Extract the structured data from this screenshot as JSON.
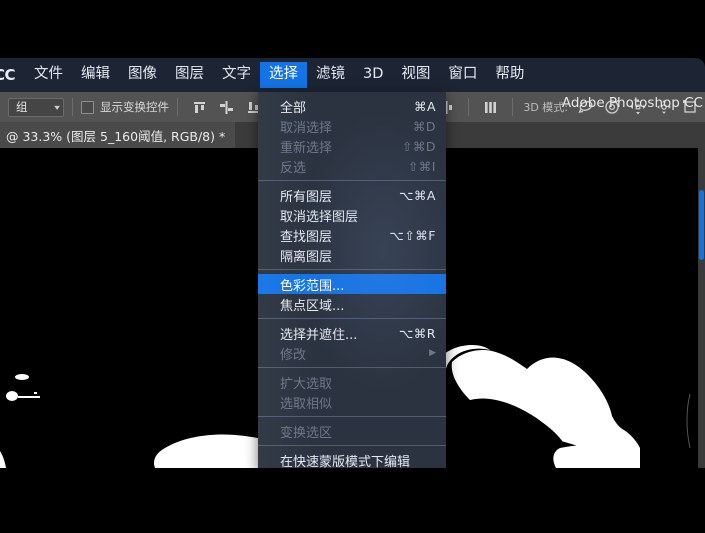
{
  "app": {
    "logo": "CC",
    "title": "Adobe Photoshop CC"
  },
  "menubar": {
    "items": [
      {
        "label": "文件",
        "active": false
      },
      {
        "label": "编辑",
        "active": false
      },
      {
        "label": "图像",
        "active": false
      },
      {
        "label": "图层",
        "active": false
      },
      {
        "label": "文字",
        "active": false
      },
      {
        "label": "选择",
        "active": true
      },
      {
        "label": "滤镜",
        "active": false
      },
      {
        "label": "3D",
        "active": false
      },
      {
        "label": "视图",
        "active": false
      },
      {
        "label": "窗口",
        "active": false
      },
      {
        "label": "帮助",
        "active": false
      }
    ]
  },
  "options_bar": {
    "group_select_value": "组",
    "show_transform_controls_label": "显示变换控件",
    "show_transform_controls_checked": false,
    "align_icons": [
      "align-top-edges-icon",
      "align-vertical-centers-icon",
      "align-bottom-edges-icon",
      "align-left-edges-icon",
      "align-horizontal-centers-icon",
      "align-right-edges-icon",
      "distribute-icon"
    ],
    "mode_3d_label": "3D 模式:",
    "mode_3d_icons": [
      "orbit-3d-icon",
      "roll-3d-icon",
      "pan-3d-icon",
      "slide-3d-icon",
      "scale-3d-icon"
    ]
  },
  "document": {
    "tab_label": "@ 33.3% (图层 5_160阈值, RGB/8) *",
    "zoom": "33.3%",
    "layer_name": "图层 5_160阈值",
    "color_mode": "RGB/8",
    "modified": true
  },
  "select_menu": {
    "title": "选择",
    "items": [
      {
        "label": "全部",
        "shortcut": "⌘A",
        "state": "enabled"
      },
      {
        "label": "取消选择",
        "shortcut": "⌘D",
        "state": "disabled"
      },
      {
        "label": "重新选择",
        "shortcut": "⇧⌘D",
        "state": "disabled"
      },
      {
        "label": "反选",
        "shortcut": "⇧⌘I",
        "state": "disabled"
      },
      {
        "type": "separator"
      },
      {
        "label": "所有图层",
        "shortcut": "⌥⌘A",
        "state": "enabled"
      },
      {
        "label": "取消选择图层",
        "shortcut": "",
        "state": "enabled"
      },
      {
        "label": "查找图层",
        "shortcut": "⌥⇧⌘F",
        "state": "enabled"
      },
      {
        "label": "隔离图层",
        "shortcut": "",
        "state": "enabled"
      },
      {
        "type": "separator"
      },
      {
        "label": "色彩范围...",
        "shortcut": "",
        "state": "selected"
      },
      {
        "label": "焦点区域...",
        "shortcut": "",
        "state": "enabled"
      },
      {
        "type": "separator"
      },
      {
        "label": "选择并遮住...",
        "shortcut": "⌥⌘R",
        "state": "enabled"
      },
      {
        "label": "修改",
        "shortcut": "",
        "state": "disabled",
        "submenu": true
      },
      {
        "type": "separator"
      },
      {
        "label": "扩大选取",
        "shortcut": "",
        "state": "disabled"
      },
      {
        "label": "选取相似",
        "shortcut": "",
        "state": "disabled"
      },
      {
        "type": "separator"
      },
      {
        "label": "变换选区",
        "shortcut": "",
        "state": "disabled"
      },
      {
        "type": "separator"
      },
      {
        "label": "在快速蒙版模式下编辑",
        "shortcut": "",
        "state": "enabled"
      }
    ]
  },
  "canvas": {
    "description": "高对比度黑白阈值人像 — 眼睛与眉毛特写",
    "background_color": "#000000",
    "foreground_color": "#ffffff"
  },
  "colors": {
    "menubar_bg": "#1d2433",
    "menu_bg": "#2b3340",
    "accent": "#1473e6",
    "options_bar_bg": "#535353",
    "tab_bar_bg": "#3b3b3b",
    "canvas_bg": "#000000"
  }
}
